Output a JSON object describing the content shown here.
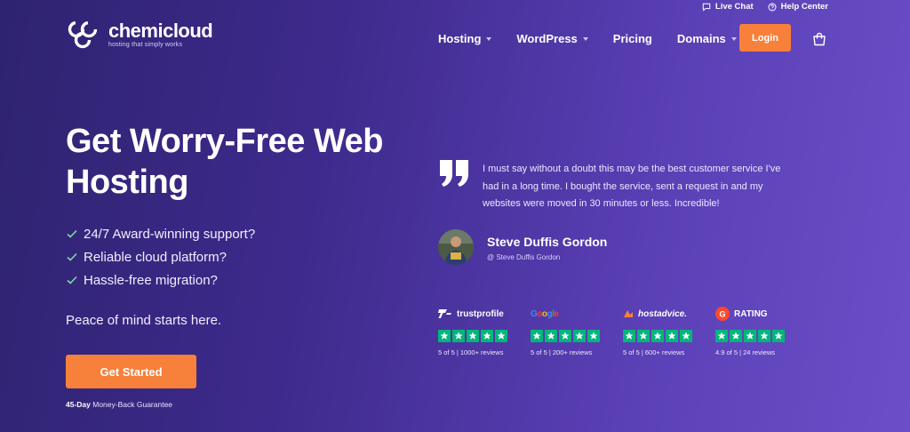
{
  "topbar": {
    "live_chat": "Live Chat",
    "help_center": "Help Center"
  },
  "logo": {
    "name": "chemicloud",
    "tagline": "hosting that simply works"
  },
  "nav": {
    "items": [
      {
        "label": "Hosting",
        "has_dropdown": true
      },
      {
        "label": "WordPress",
        "has_dropdown": true
      },
      {
        "label": "Pricing",
        "has_dropdown": false
      },
      {
        "label": "Domains",
        "has_dropdown": true
      }
    ],
    "login": "Login",
    "cart_icon": "cart-icon"
  },
  "hero": {
    "title": "Get Worry-Free Web Hosting",
    "features": [
      "24/7 Award-winning support?",
      "Reliable cloud platform?",
      "Hassle-free migration?"
    ],
    "tagline": "Peace of mind starts here.",
    "cta": "Get Started",
    "guarantee_bold": "45-Day",
    "guarantee_rest": " Money-Back Guarantee"
  },
  "testimonial": {
    "quote": "I must say without a doubt this may be the best customer service I've had in a long time. I bought the service, sent a request in and my websites were moved in 30 minutes or less. Incredible!",
    "author": "Steve Duffis Gordon",
    "handle": "@ Steve Duffis Gordon"
  },
  "reviews": [
    {
      "brand": "trustprofile",
      "stars": 5,
      "meta": "5 of 5 | 1000+ reviews"
    },
    {
      "brand": "Google",
      "stars": 5,
      "meta": "5 of 5 | 200+ reviews"
    },
    {
      "brand": "hostadvice.",
      "stars": 5,
      "meta": "5 of 5 | 600+ reviews"
    },
    {
      "brand": "RATING",
      "stars": 5,
      "meta": "4.9 of 5 | 24 reviews"
    }
  ],
  "colors": {
    "accent": "#f7803a",
    "star_green": "#00b67a",
    "background_start": "#2e2370",
    "background_end": "#6b4fc9"
  }
}
